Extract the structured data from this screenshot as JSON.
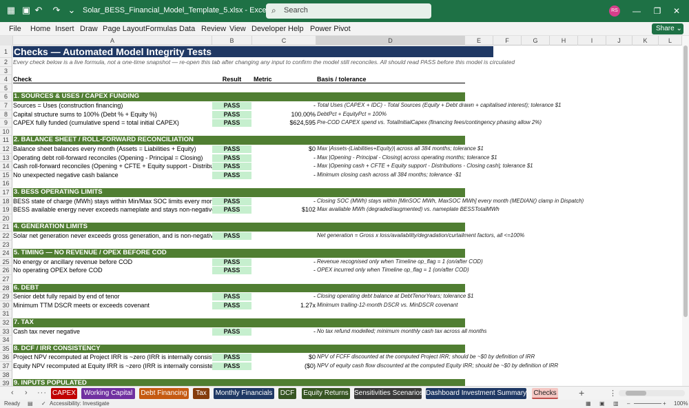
{
  "window": {
    "file_name": "Solar_BESS_Financial_Model_Template_5.xlsx  -  Excel",
    "search_placeholder": "Search",
    "avatar_initials": "RS",
    "accent": "#1e7145"
  },
  "ribbon": {
    "tabs": [
      "File",
      "Home",
      "Insert",
      "Draw",
      "Page Layout",
      "Formulas",
      "Data",
      "Review",
      "View",
      "Developer",
      "Help",
      "Power Pivot"
    ],
    "share_label": "Share"
  },
  "columns": [
    "A",
    "B",
    "C",
    "D",
    "E",
    "F",
    "G",
    "H",
    "I",
    "J",
    "K",
    "L"
  ],
  "sheet": {
    "title": "Checks — Automated Model Integrity Tests",
    "subtitle": "Every check below is a live formula, not a one-time snapshot — re-open this tab after changing any input to confirm the model still reconciles. All should read PASS before this model is circulated",
    "headers": {
      "check": "Check",
      "result": "Result",
      "metric": "Metric",
      "basis": "Basis / tolerance"
    },
    "rows": [
      {
        "n": "1",
        "kind": "title"
      },
      {
        "n": "2",
        "kind": "subtitle"
      },
      {
        "n": "3",
        "kind": "blank"
      },
      {
        "n": "4",
        "kind": "header"
      },
      {
        "n": "5",
        "kind": "blank"
      },
      {
        "n": "6",
        "kind": "band",
        "label": "1. SOURCES & USES / CAPEX FUNDING"
      },
      {
        "n": "7",
        "kind": "check",
        "check": "Sources = Uses (construction financing)",
        "result": "PASS",
        "metric": "-",
        "basis": "Total Uses (CAPEX + IDC) - Total Sources (Equity + Debt drawn + capitalised interest); tolerance $1"
      },
      {
        "n": "8",
        "kind": "check",
        "check": "Capital structure sums to 100% (Debt % + Equity %)",
        "result": "PASS",
        "metric": "100.00%",
        "basis": "DebtPct + EquityPct = 100%"
      },
      {
        "n": "9",
        "kind": "check",
        "check": "CAPEX fully funded (cumulative spend = total initial CAPEX)",
        "result": "PASS",
        "metric": "$624,595",
        "basis": "Pre-COD CAPEX spend vs. TotalInitialCapex (financing fees/contingency phasing allow 2%)"
      },
      {
        "n": "10",
        "kind": "blank"
      },
      {
        "n": "11",
        "kind": "band",
        "label": "2. BALANCE SHEET / ROLL-FORWARD RECONCILIATION"
      },
      {
        "n": "12",
        "kind": "check",
        "check": "Balance sheet balances every month (Assets = Liabilities + Equity)",
        "result": "PASS",
        "metric": "$0",
        "basis": "Max |Assets-(Liabilities+Equity)| across all 384 months; tolerance $1"
      },
      {
        "n": "13",
        "kind": "check",
        "check": "Operating debt roll-forward reconciles (Opening - Principal = Closing)",
        "result": "PASS",
        "metric": "-",
        "basis": "Max |Opening - Principal - Closing| across operating months; tolerance $1"
      },
      {
        "n": "14",
        "kind": "check",
        "check": "Cash roll-forward reconciles (Opening + CFTE + Equity support - Distributio",
        "result": "PASS",
        "metric": "-",
        "basis": "Max |Opening cash + CFTE + Equity support - Distributions - Closing cash|; tolerance $1"
      },
      {
        "n": "15",
        "kind": "check",
        "check": "No unexpected negative cash balance",
        "result": "PASS",
        "metric": "-",
        "basis": "Minimum closing cash across all 384 months; tolerance -$1"
      },
      {
        "n": "16",
        "kind": "blank"
      },
      {
        "n": "17",
        "kind": "band",
        "label": "3. BESS OPERATING LIMITS"
      },
      {
        "n": "18",
        "kind": "check",
        "check": "BESS state of charge (MWh) stays within Min/Max SOC limits every month",
        "result": "PASS",
        "metric": "-",
        "basis": "Closing SOC (MWh) stays within [MinSOC MWh, MaxSOC MWh] every month (MEDIAN() clamp in Dispatch)"
      },
      {
        "n": "19",
        "kind": "check",
        "check": "BESS available energy never exceeds nameplate and stays non-negative",
        "result": "PASS",
        "metric": "$102",
        "basis": "Max available MWh (degraded/augmented) vs. nameplate BESSTotalMWh"
      },
      {
        "n": "20",
        "kind": "blank"
      },
      {
        "n": "21",
        "kind": "band",
        "label": "4. GENERATION LIMITS"
      },
      {
        "n": "22",
        "kind": "check",
        "check": "Solar net generation never exceeds gross generation, and is non-negative",
        "result": "PASS",
        "metric": "",
        "basis": "Net generation = Gross x loss/availability/degradation/curtailment factors, all <=100%"
      },
      {
        "n": "23",
        "kind": "blank"
      },
      {
        "n": "24",
        "kind": "band",
        "label": "5. TIMING — NO REVENUE / OPEX BEFORE COD"
      },
      {
        "n": "25",
        "kind": "check",
        "check": "No energy or ancillary revenue before COD",
        "result": "PASS",
        "metric": "-",
        "basis": "Revenue recognised only when Timeline op_flag = 1 (on/after COD)"
      },
      {
        "n": "26",
        "kind": "check",
        "check": "No operating OPEX before COD",
        "result": "PASS",
        "metric": "-",
        "basis": "OPEX incurred only when Timeline op_flag = 1 (on/after COD)"
      },
      {
        "n": "27",
        "kind": "blank"
      },
      {
        "n": "28",
        "kind": "band",
        "label": "6. DEBT"
      },
      {
        "n": "29",
        "kind": "check",
        "check": "Senior debt fully repaid by end of tenor",
        "result": "PASS",
        "metric": "-",
        "basis": "Closing operating debt balance at DebtTenorYears; tolerance $1"
      },
      {
        "n": "30",
        "kind": "check",
        "check": "Minimum TTM DSCR meets or exceeds covenant",
        "result": "PASS",
        "metric": "1.27x",
        "basis": "Minimum trailing-12-month DSCR vs. MinDSCR covenant"
      },
      {
        "n": "31",
        "kind": "blank"
      },
      {
        "n": "32",
        "kind": "band",
        "label": "7. TAX"
      },
      {
        "n": "33",
        "kind": "check",
        "check": "Cash tax never negative",
        "result": "PASS",
        "metric": "-",
        "basis": "No tax refund modelled; minimum monthly cash tax across all months"
      },
      {
        "n": "34",
        "kind": "blank"
      },
      {
        "n": "35",
        "kind": "band",
        "label": "8. DCF / IRR CONSISTENCY"
      },
      {
        "n": "36",
        "kind": "check",
        "check": "Project NPV recomputed at Project IRR is ~zero (IRR is internally consistent",
        "result": "PASS",
        "metric": "$0",
        "basis": "NPV of FCFF discounted at the computed Project IRR; should be ~$0 by definition of IRR"
      },
      {
        "n": "37",
        "kind": "check",
        "check": "Equity NPV recomputed at Equity IRR is ~zero (IRR is internally consistent)",
        "result": "PASS",
        "metric": "($0)",
        "basis": "NPV of equity cash flow discounted at the computed Equity IRR; should be ~$0 by definition of IRR"
      },
      {
        "n": "38",
        "kind": "blank"
      },
      {
        "n": "39",
        "kind": "band",
        "label": "9. INPUTS POPULATED"
      }
    ]
  },
  "sheet_tabs": [
    {
      "label": "CAPEX",
      "color": "#c00000"
    },
    {
      "label": "Working Capital",
      "color": "#7030a0"
    },
    {
      "label": "Debt Financing",
      "color": "#c55a11"
    },
    {
      "label": "Tax",
      "color": "#843c0c"
    },
    {
      "label": "Monthly Financials",
      "color": "#1f3864"
    },
    {
      "label": "DCF",
      "color": "#375623"
    },
    {
      "label": "Equity Returns",
      "color": "#375623"
    },
    {
      "label": "Sensitivities Scenarios",
      "color": "#3a3a3a"
    },
    {
      "label": "Dashboard Investment Summary",
      "color": "#1f3864"
    },
    {
      "label": "Checks",
      "color": "#f4c7c3"
    }
  ],
  "status": {
    "ready": "Ready",
    "accessibility": "Accessibility: Investigate",
    "zoom": "100%"
  }
}
